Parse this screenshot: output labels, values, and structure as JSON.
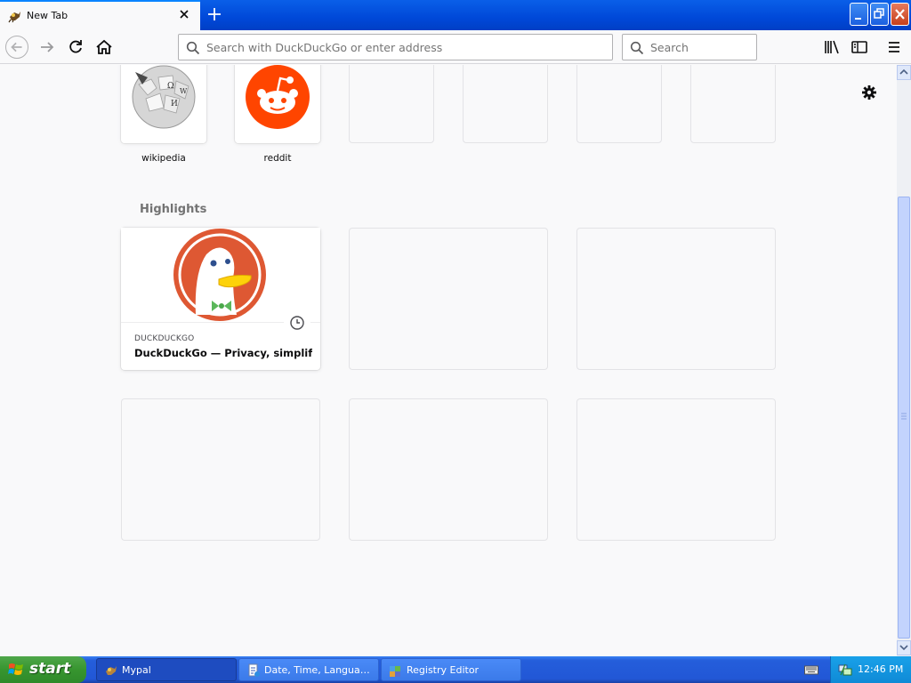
{
  "tab": {
    "title": "New Tab"
  },
  "urlbar": {
    "placeholder": "Search with DuckDuckGo or enter address"
  },
  "searchbar": {
    "placeholder": "Search"
  },
  "top_sites": [
    {
      "label": "wikipedia",
      "icon": "wikipedia-globe-icon"
    },
    {
      "label": "reddit",
      "icon": "reddit-alien-icon",
      "color": "#ff4500"
    },
    {
      "label": "",
      "icon": ""
    },
    {
      "label": "",
      "icon": ""
    },
    {
      "label": "",
      "icon": ""
    },
    {
      "label": "",
      "icon": ""
    }
  ],
  "highlights": {
    "title": "Highlights",
    "cards": [
      {
        "source": "DUCKDUCKGO",
        "title": "DuckDuckGo — Privacy, simplifi...",
        "icon": "duckduckgo-logo",
        "color": "#de5833",
        "badge_icon": "clock-icon"
      }
    ]
  },
  "taskbar": {
    "start_label": "start",
    "tasks": [
      {
        "label": "Mypal",
        "icon": "mypal-icon",
        "active": true
      },
      {
        "label": "Date, Time, Languag...",
        "icon": "control-panel-icon",
        "active": false
      },
      {
        "label": "Registry Editor",
        "icon": "registry-editor-icon",
        "active": false
      }
    ],
    "clock": "12:46 PM"
  },
  "colors": {
    "titlebar": "#0048d8",
    "taskbar": "#245edb",
    "start": "#37952f",
    "tray": "#0f8ad6"
  }
}
